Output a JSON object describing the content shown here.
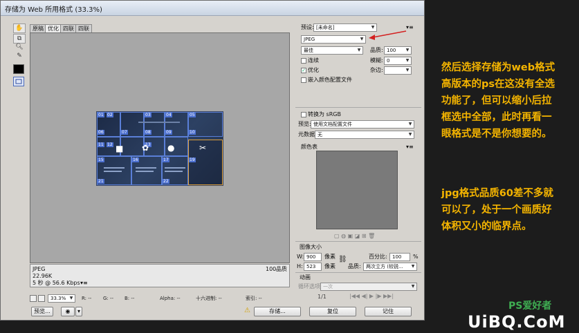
{
  "window": {
    "title": "存储为 Web 所用格式 (33.3%)"
  },
  "view_tabs": [
    "原稿",
    "优化",
    "四联",
    "四联"
  ],
  "status_info": {
    "format": "JPEG",
    "size": "22.96K",
    "time": "5 秒 @ 56.6 Kbps",
    "quality_value": "100",
    "quality_label": "品质"
  },
  "statusbar": {
    "zoom": "33.3%",
    "r": "R: --",
    "g": "G: --",
    "b": "B: --",
    "alpha": "Alpha: --",
    "hex": "十六进制: --",
    "index": "索引: --"
  },
  "bottom_buttons": {
    "preview": "预览...",
    "save": "存储...",
    "reset": "复位",
    "remember": "记住"
  },
  "settings": {
    "preset_label": "预设:",
    "preset_value": "[未命名]",
    "format_value": "JPEG",
    "quality_preset": "最佳",
    "quality_label": "品质:",
    "quality_value": "100",
    "progressive_label": "连续",
    "blur_label": "模糊:",
    "blur_value": "0",
    "optimized_label": "优化",
    "matte_label": "杂边:",
    "embed_profile_label": "嵌入颜色配置文件",
    "convert_srgb_label": "转换为 sRGB",
    "preview_label": "预览:",
    "preview_value": "使用文档配置文件",
    "metadata_label": "元数据:",
    "metadata_value": "无",
    "color_table_label": "颜色表",
    "image_size_label": "图像大小",
    "w_label": "W:",
    "w_value": "900",
    "h_label": "H:",
    "h_value": "523",
    "pixels_unit": "像素",
    "percent_label": "百分比:",
    "percent_value": "100",
    "percent_unit": "%",
    "quality2_label": "品质:",
    "quality2_value": "两次立方 (较锐...",
    "animation_label": "动画",
    "loop_label": "循环选项:",
    "loop_value": "一次",
    "frame_counter": "1/1"
  },
  "slices": [
    "01",
    "02",
    "03",
    "04",
    "05",
    "06",
    "07",
    "08",
    "09",
    "10",
    "11",
    "12",
    "13",
    "14",
    "15",
    "16",
    "17",
    "18",
    "19",
    "21",
    "22",
    "23"
  ],
  "annotation_1": [
    "然后选择存储为web格式",
    "高版本的ps在这没有全选",
    "功能了，但可以缩小后拉",
    "框选中全部，此时再看一",
    "眼格式是不是你想要的。"
  ],
  "annotation_2": [
    "jpg格式品质60差不多就",
    "可以了，处于一个画质好",
    "体积又小的临界点。"
  ],
  "watermark": {
    "logo": "UiBQ.CoM",
    "sub": "PS爱好者"
  },
  "colors": {
    "annotation": "#f4b400",
    "slice_border": "#5a7fd8",
    "selection": "#e1a33c",
    "arrow": "#d32020"
  }
}
